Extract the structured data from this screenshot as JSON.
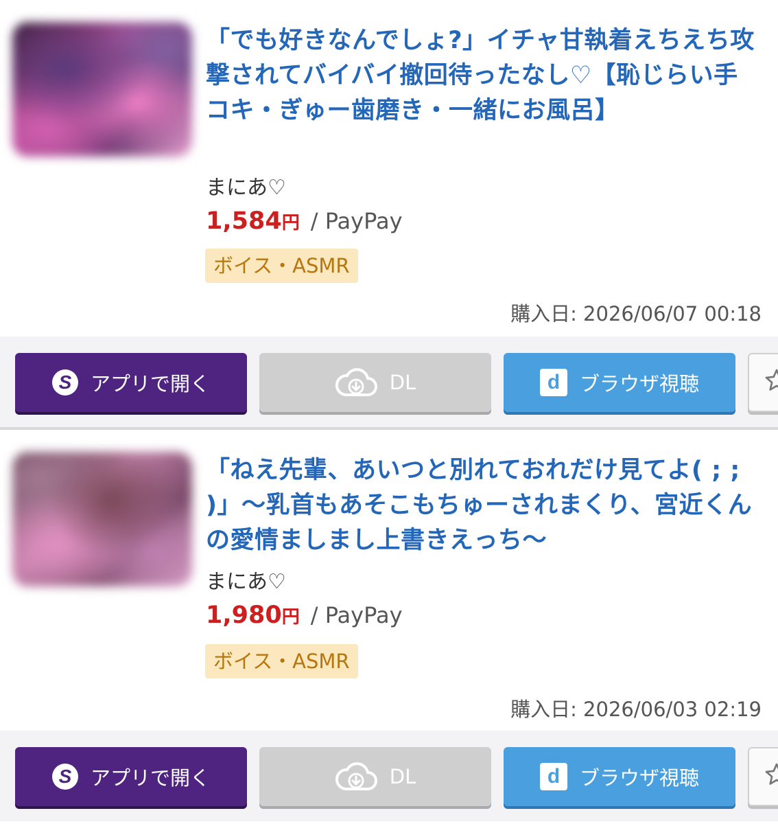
{
  "items": [
    {
      "title": "「でも好きなんでしょ?」イチャ甘執着えちえち攻撃されてバイバイ撤回待ったなし♡【恥じらい手コキ・ぎゅー歯磨き・一緒にお風呂】",
      "maker": "まにあ♡",
      "price": "1,584",
      "currency": "円",
      "payment": "/ PayPay",
      "category": "ボイス・ASMR",
      "purchase_date": "購入日: 2026/06/07 00:18"
    },
    {
      "title": "「ねえ先輩、あいつと別れておれだけ見てよ( ; ; )」〜乳首もあそこもちゅーされまくり、宮近くんの愛情ましまし上書きえっち〜",
      "maker": "まにあ♡",
      "price": "1,980",
      "currency": "円",
      "payment": "/ PayPay",
      "category": "ボイス・ASMR",
      "purchase_date": "購入日: 2026/06/03 02:19"
    }
  ],
  "buttons": {
    "open_app": "アプリで開く",
    "download": "DL",
    "browser": "ブラウザ視聴"
  },
  "icons": {
    "app": "app-logo-icon",
    "download": "cloud-download-icon",
    "browser": "browser-d-icon",
    "favorite": "star-icon"
  },
  "colors": {
    "title": "#2466b8",
    "price": "#cc1f1f",
    "badge_bg": "#fbe8be",
    "badge_text": "#b8760e",
    "app_button": "#4f2480",
    "dl_button": "#cfcfcf",
    "browser_button": "#4aa0df"
  }
}
